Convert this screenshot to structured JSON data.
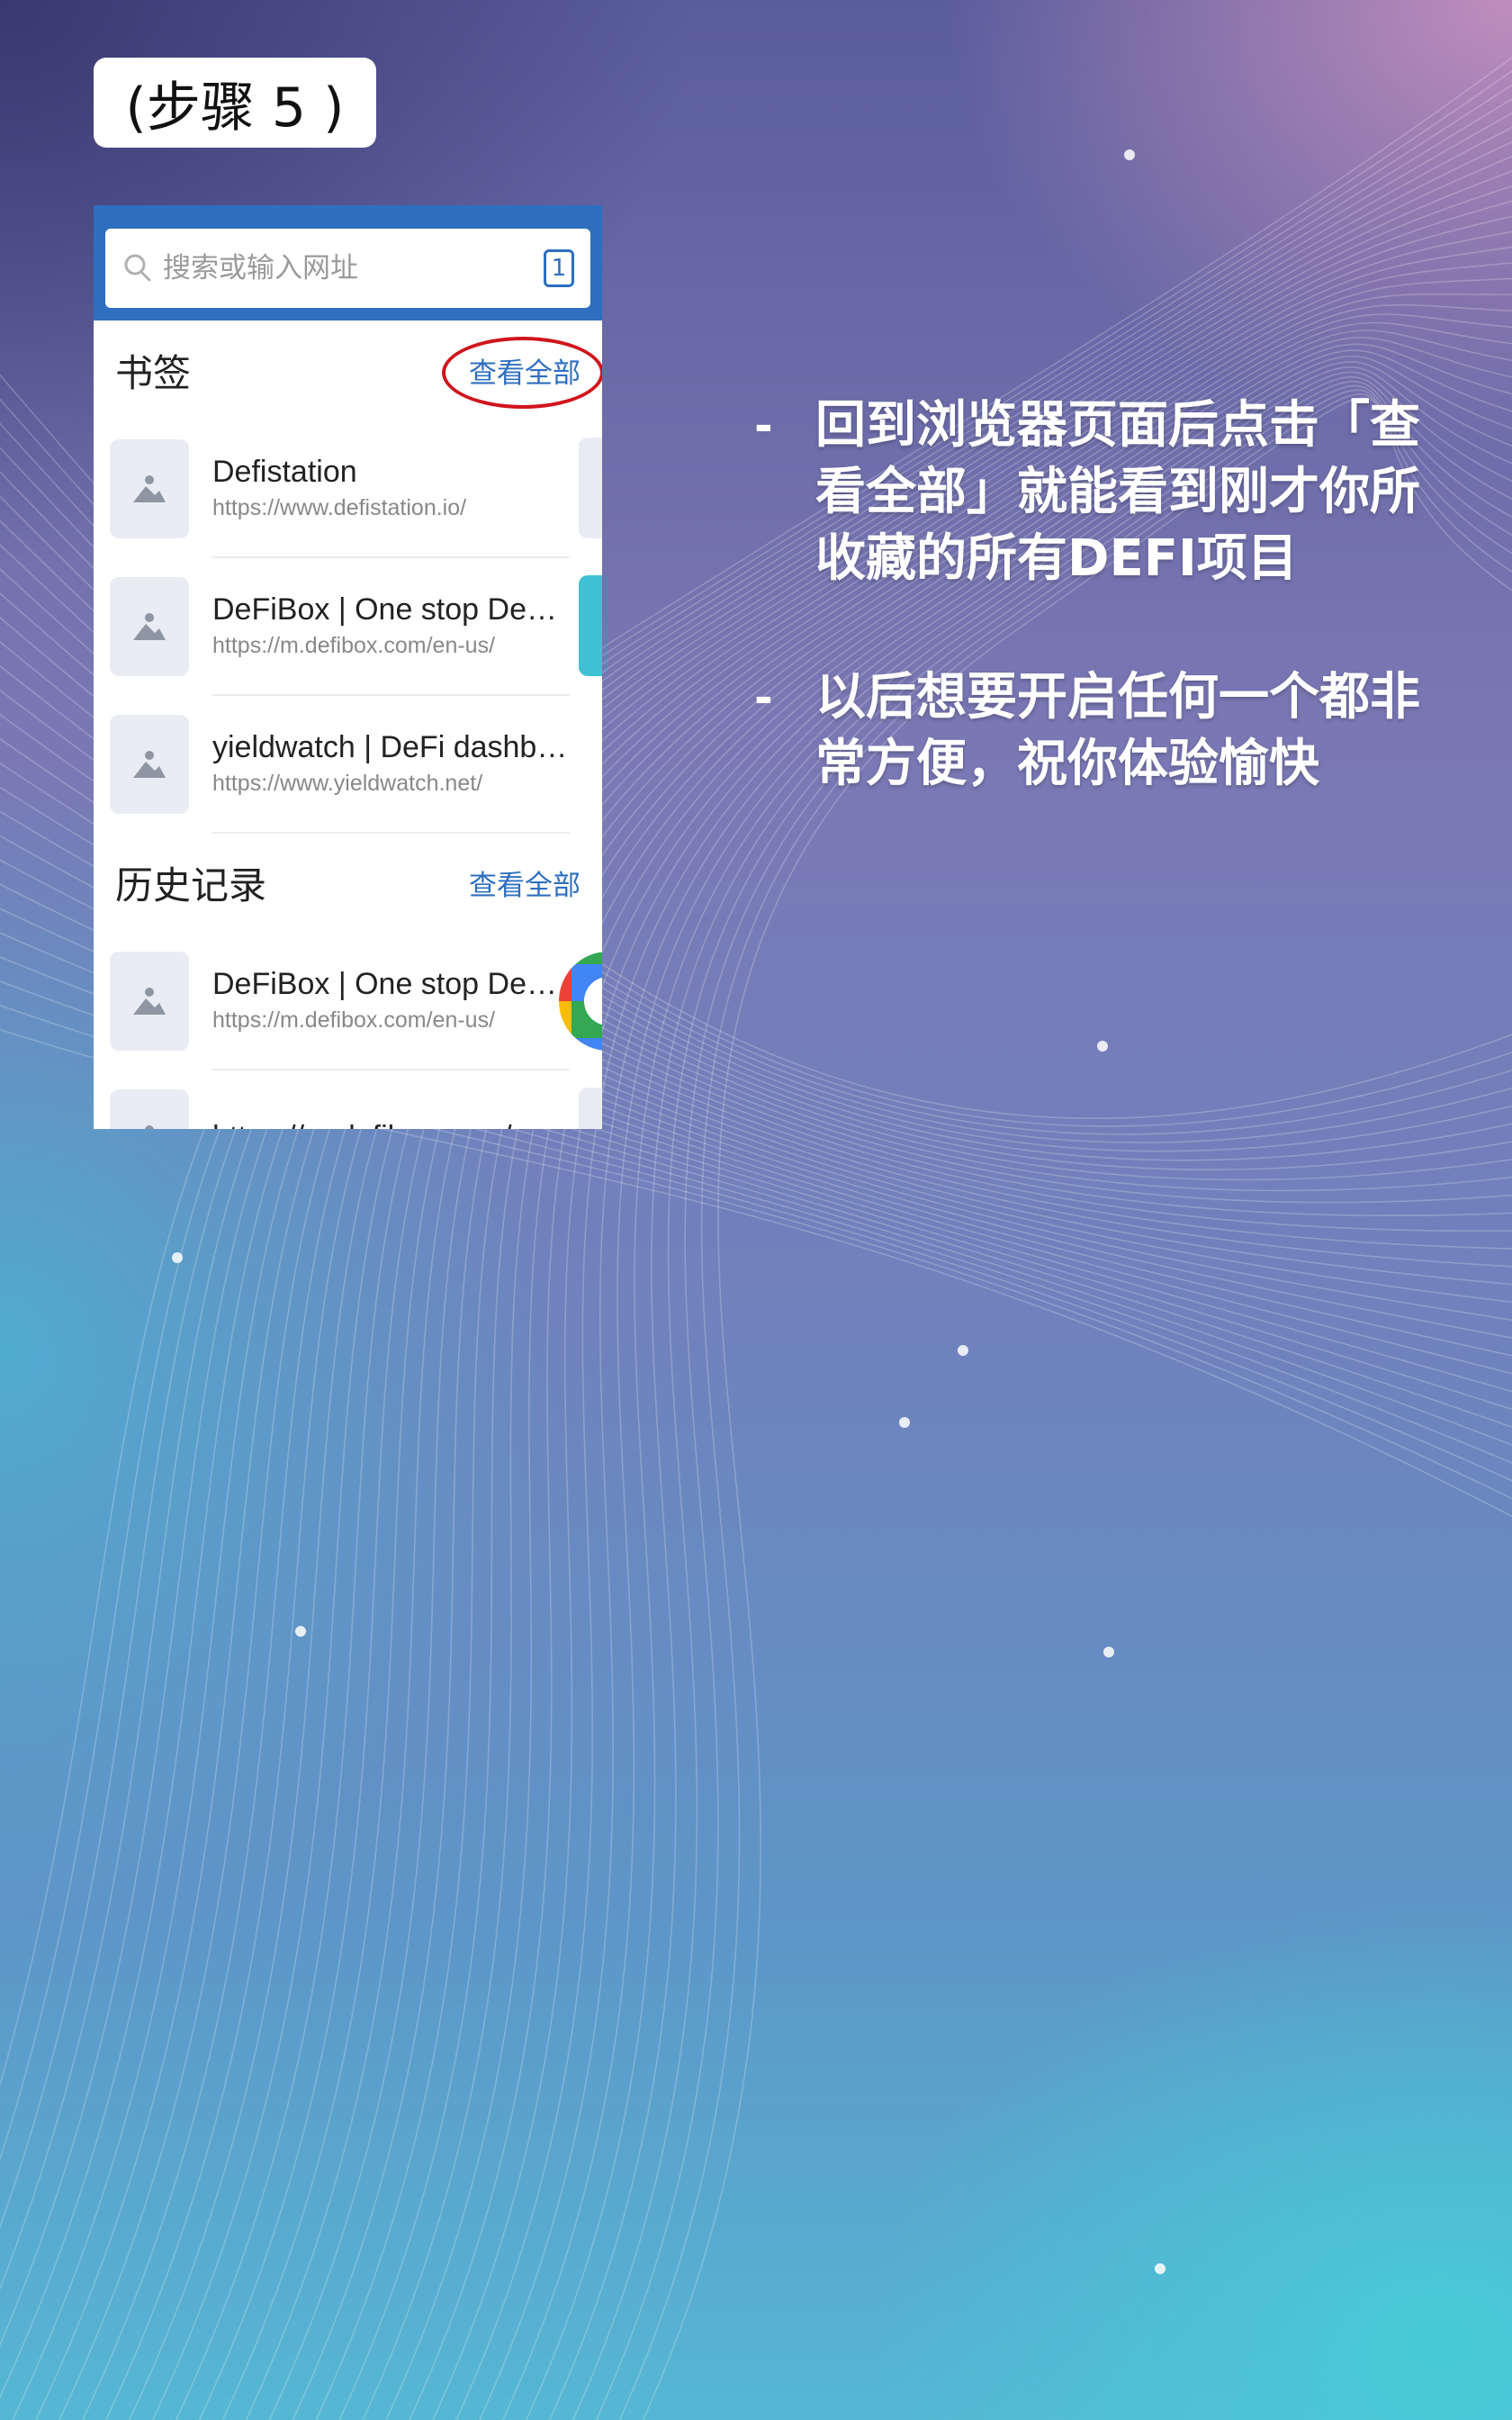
{
  "step_label": "(步骤 5 )",
  "browser": {
    "search_placeholder": "搜索或输入网址",
    "tab_count": "1",
    "bookmarks": {
      "title": "书签",
      "view_all": "查看全部",
      "items": [
        {
          "title": "Defistation",
          "url": "https://www.defistation.io/"
        },
        {
          "title": "DeFiBox | One stop DeFi inf...",
          "url": "https://m.defibox.com/en-us/"
        },
        {
          "title": "yieldwatch | DeFi dashboard",
          "url": "https://www.yieldwatch.net/"
        }
      ]
    },
    "history": {
      "title": "历史记录",
      "view_all": "查看全部",
      "items": [
        {
          "title": "DeFiBox | One stop DeFi inf...",
          "url": "https://m.defibox.com/en-us/"
        },
        {
          "title": "https://m.defibox.com/en-us/",
          "url": ""
        }
      ]
    }
  },
  "bullets": [
    {
      "dash": "-",
      "text": "回到浏览器页面后点击「查看全部」就能看到刚才你所收藏的所有DEFI项目"
    },
    {
      "dash": "-",
      "text": "以后想要开启任何一个都非常方便，祝你体验愉快"
    }
  ],
  "colors": {
    "browser_blue": "#2e6fbf",
    "highlight_circle": "#d0141b"
  }
}
